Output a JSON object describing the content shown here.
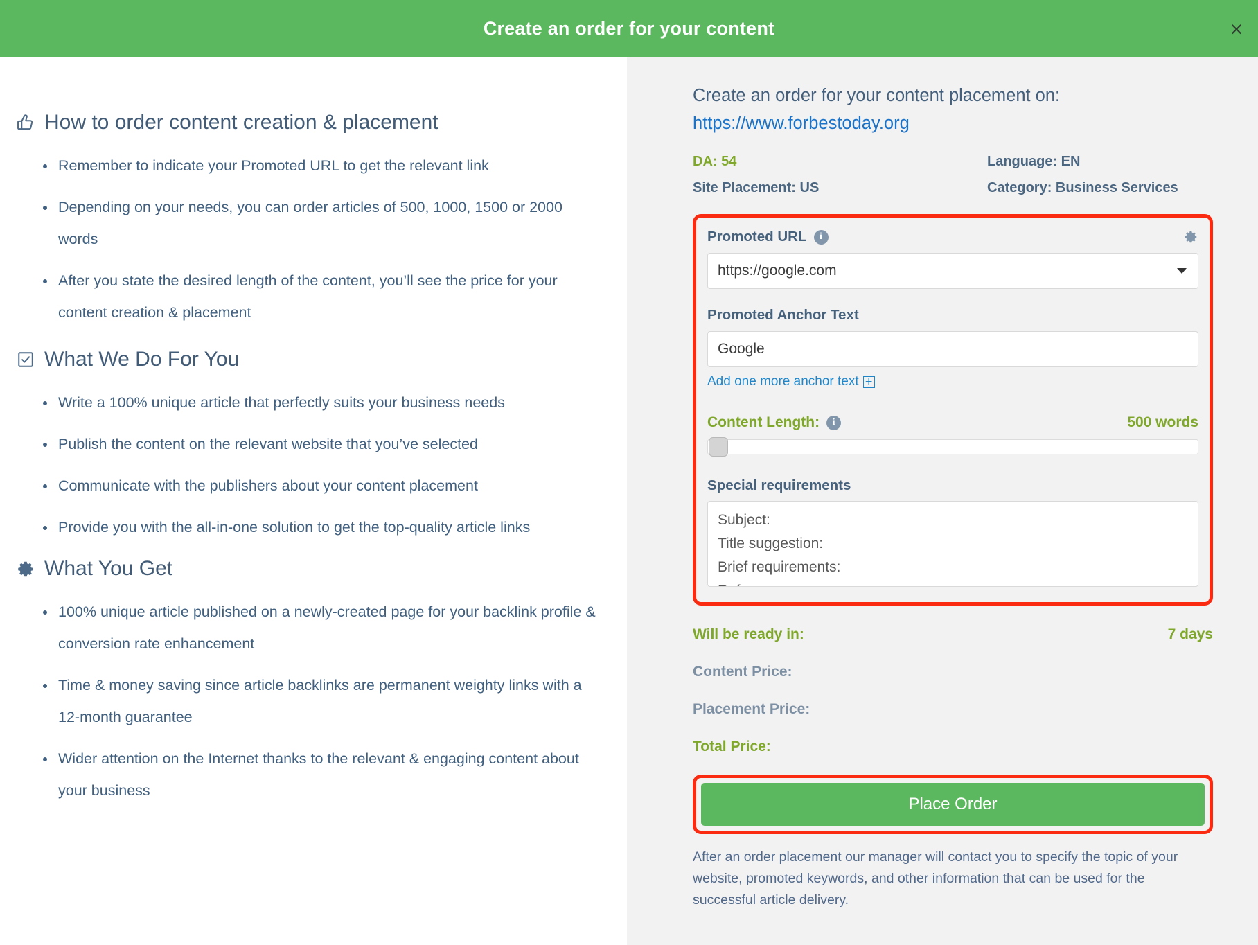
{
  "header": {
    "title": "Create an order for your content",
    "close_label": "×"
  },
  "left": {
    "sections": [
      {
        "icon": "thumbs-up-icon",
        "title": "How to order content creation & placement",
        "bullets": [
          "Remember to indicate your Promoted URL to get the relevant link",
          "Depending on your needs, you can order articles of 500, 1000, 1500 or 2000 words",
          "After you state the desired length of the content, you’ll see the price for your content creation & placement"
        ]
      },
      {
        "icon": "checkbox-checked-icon",
        "title": "What We Do For You",
        "bullets": [
          "Write a 100% unique article that perfectly suits your business needs",
          "Publish the content on the relevant website that you’ve selected",
          "Communicate with the publishers about your content placement",
          "Provide you with the all-in-one solution to get the top-quality article links"
        ]
      },
      {
        "icon": "gear-icon",
        "title": "What You Get",
        "bullets": [
          "100% unique article published on a newly-created page for your backlink profile & conversion rate enhancement",
          "Time & money saving since article backlinks are permanent weighty links with a 12-month guarantee",
          "Wider attention on the Internet thanks to the relevant & engaging content about your business"
        ]
      }
    ]
  },
  "right": {
    "order_heading": "Create an order for your content placement on:",
    "site_url": "https://www.forbestoday.org",
    "meta": {
      "da": "DA: 54",
      "language": "Language: EN",
      "site_placement": "Site Placement: US",
      "category": "Category: Business Services"
    },
    "form": {
      "promoted_url_label": "Promoted URL",
      "promoted_url_value": "https://google.com",
      "anchor_label": "Promoted Anchor Text",
      "anchor_value": "Google",
      "add_anchor_label": "Add one more anchor text",
      "add_anchor_plus": "+",
      "content_length_label": "Content Length:",
      "content_length_value": "500 words",
      "special_req_label": "Special requirements",
      "special_req_lines": [
        "Subject:",
        "Title suggestion:",
        "Brief requirements:",
        "Reference:"
      ]
    },
    "summary": {
      "ready_label": "Will be ready in:",
      "ready_value": "7 days",
      "content_price_label": "Content Price:",
      "placement_price_label": "Placement Price:",
      "total_price_label": "Total Price:"
    },
    "order_button_label": "Place Order",
    "footnote": "After an order placement our manager will contact you to specify the topic of your website, promoted keywords, and other information that can be used for the successful article delivery."
  },
  "colors": {
    "brand_green": "#5cb85f",
    "accent_olive": "#7fa72b",
    "link_blue": "#1a73c8",
    "slate": "#44607c",
    "highlight_red": "#fb2b11"
  }
}
